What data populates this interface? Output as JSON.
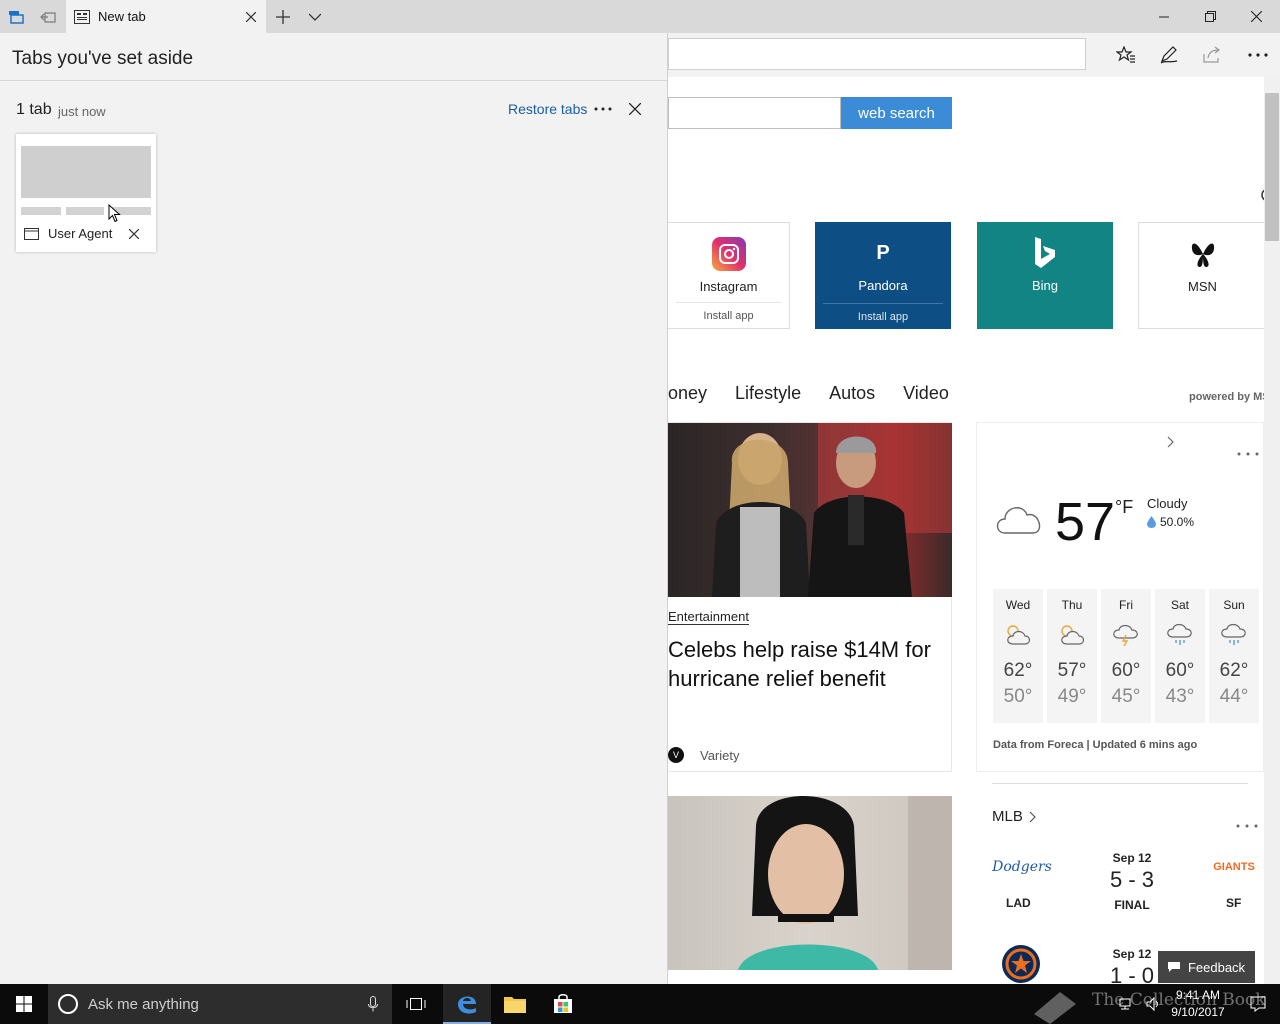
{
  "tab": {
    "title": "New tab"
  },
  "pane": {
    "title": "Tabs you've set aside",
    "group_count": "1 tab",
    "group_time": "just now",
    "restore_label": "Restore tabs",
    "more_label": "···",
    "thumb_title": "User Agent"
  },
  "newtab": {
    "search_button": "web search",
    "tiles": [
      {
        "name": "Instagram",
        "sub": "Install app"
      },
      {
        "name": "Pandora",
        "sub": "Install app",
        "logo": "P"
      },
      {
        "name": "Bing"
      },
      {
        "name": "MSN"
      }
    ],
    "news_nav": [
      "oney",
      "Lifestyle",
      "Autos",
      "Video"
    ],
    "powered_by": "powered by MS",
    "article": {
      "category": "Entertainment",
      "headline": "Celebs help raise $14M for hurricane relief benefit",
      "source": "Variety"
    },
    "weather": {
      "temp": "57",
      "unit": "°F",
      "condition": "Cloudy",
      "precip": "50.0%",
      "days": [
        {
          "name": "Wed",
          "hi": "62°",
          "lo": "50°",
          "icon": "partly-sunny-icon"
        },
        {
          "name": "Thu",
          "hi": "57°",
          "lo": "49°",
          "icon": "partly-sunny-icon"
        },
        {
          "name": "Fri",
          "hi": "60°",
          "lo": "45°",
          "icon": "thunderstorm-icon"
        },
        {
          "name": "Sat",
          "hi": "60°",
          "lo": "43°",
          "icon": "rain-icon"
        },
        {
          "name": "Sun",
          "hi": "62°",
          "lo": "44°",
          "icon": "rain-icon"
        }
      ],
      "footer": "Data from Foreca | Updated 6 mins ago"
    },
    "mlb": {
      "title": "MLB",
      "game1": {
        "date": "Sep 12",
        "score": "5 - 3",
        "status": "FINAL",
        "home": "LAD",
        "away": "SF",
        "home_logo": "Dodgers",
        "away_logo": "GIANTS"
      },
      "game2": {
        "date": "Sep 12",
        "score": "1 - 0"
      }
    },
    "feedback": "Feedback"
  },
  "taskbar": {
    "search_placeholder": "Ask me anything",
    "time": "9:41 AM",
    "date": "9/10/2017",
    "watermark": "The Collection Book"
  },
  "colors": {
    "accent": "#3b8bd6",
    "pandora": "#0d4f85",
    "bing": "#138484",
    "link": "#1a5ea8"
  }
}
